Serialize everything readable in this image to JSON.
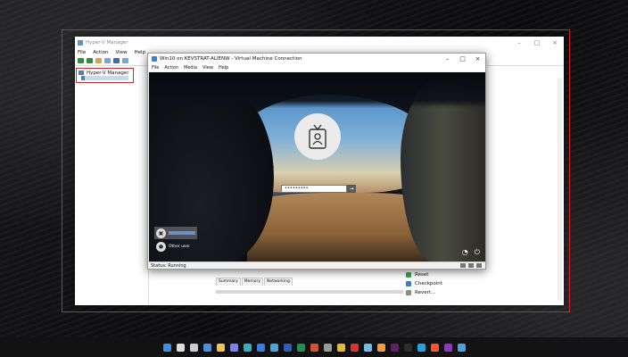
{
  "hyperv": {
    "title": "Hyper-V Manager",
    "menu": [
      "File",
      "Action",
      "View",
      "Help"
    ],
    "tree_root": "Hyper-V Manager",
    "tabs": [
      "Summary",
      "Memory",
      "Networking"
    ],
    "actions": [
      {
        "label": "Reset",
        "icon": "reset-icon",
        "color": "#3aa14a"
      },
      {
        "label": "Checkpoint",
        "icon": "checkpoint-icon",
        "color": "#3a7fc8"
      },
      {
        "label": "Revert...",
        "icon": "revert-icon",
        "color": "#8a8a8a"
      }
    ]
  },
  "vm": {
    "title": "Win10 on KEVSTRAT-ALIENW - Virtual Machine Connection",
    "menu": [
      "File",
      "Action",
      "Media",
      "View",
      "Help"
    ],
    "password_dots": "•••••••••",
    "submit_glyph": "→",
    "other_user": "Other user",
    "status": "Status: Running"
  },
  "colors": {
    "highlight": "#d8232a",
    "action_header": "#cfe0f2"
  },
  "taskbar": {
    "icons": [
      {
        "name": "start-icon",
        "color": "#3b8eea"
      },
      {
        "name": "search-icon",
        "color": "#dddddd"
      },
      {
        "name": "task-view-icon",
        "color": "#cccccc"
      },
      {
        "name": "widgets-icon",
        "color": "#4a90d9"
      },
      {
        "name": "file-explorer-icon",
        "color": "#f2c14e"
      },
      {
        "name": "teams-icon",
        "color": "#7b83eb"
      },
      {
        "name": "edge-icon",
        "color": "#2fb3c4"
      },
      {
        "name": "photos-icon",
        "color": "#3b7dd8"
      },
      {
        "name": "store-icon",
        "color": "#4aa3df"
      },
      {
        "name": "word-icon",
        "color": "#2b5fb4"
      },
      {
        "name": "excel-icon",
        "color": "#1e8f4e"
      },
      {
        "name": "powerpoint-icon",
        "color": "#d35230"
      },
      {
        "name": "settings-icon",
        "color": "#9a9a9a"
      },
      {
        "name": "chrome-icon",
        "color": "#e3b83b"
      },
      {
        "name": "opera-icon",
        "color": "#e0302e"
      },
      {
        "name": "notepad-icon",
        "color": "#78b9e6"
      },
      {
        "name": "paint-icon",
        "color": "#f29b3a"
      },
      {
        "name": "slack-icon",
        "color": "#611f69"
      },
      {
        "name": "terminal-icon",
        "color": "#2d2d2d"
      },
      {
        "name": "vscode-icon",
        "color": "#2a9fe0"
      },
      {
        "name": "brave-icon",
        "color": "#fb542b"
      },
      {
        "name": "onenote-icon",
        "color": "#8a3ab9"
      },
      {
        "name": "remote-desktop-icon",
        "color": "#4aa3df"
      }
    ]
  }
}
